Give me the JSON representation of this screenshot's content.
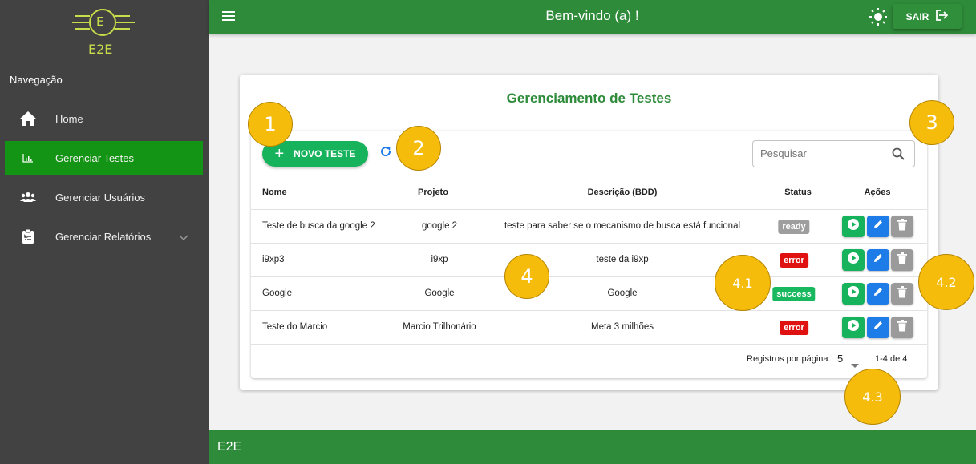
{
  "sidebar": {
    "logo_letter": "E",
    "logo_text": "E2E",
    "nav_title": "Navegação",
    "items": [
      {
        "label": "Home",
        "icon": "home-icon"
      },
      {
        "label": "Gerenciar Testes",
        "icon": "bar-chart-icon",
        "active": true
      },
      {
        "label": "Gerenciar Usuários",
        "icon": "users-icon"
      },
      {
        "label": "Gerenciar Relatórios",
        "icon": "clipboard-icon"
      }
    ]
  },
  "header": {
    "title": "Bem-vindo (a) !",
    "sair_label": "SAIR"
  },
  "card": {
    "title": "Gerenciamento de Testes",
    "new_button_label": "NOVO TESTE",
    "search_placeholder": "Pesquisar",
    "columns": [
      "Nome",
      "Projeto",
      "Descrição (BDD)",
      "Status",
      "Ações"
    ],
    "rows": [
      {
        "nome": "Teste de busca da google 2",
        "projeto": "google 2",
        "descricao": "teste para saber se o mecanismo de busca está funcional",
        "status": "ready"
      },
      {
        "nome": "i9xp3",
        "projeto": "i9xp",
        "descricao": "teste da i9xp",
        "status": "error"
      },
      {
        "nome": "Google",
        "projeto": "Google",
        "descricao": "Google",
        "status": "success"
      },
      {
        "nome": "Teste do Marcio",
        "projeto": "Marcio Trilhonário",
        "descricao": "Meta 3 milhões",
        "status": "error"
      }
    ],
    "pagination": {
      "rows_per_page_label": "Registros por página:",
      "rows_per_page": "5",
      "range": "1-4 de 4"
    }
  },
  "annotations": [
    "1",
    "2",
    "3",
    "4",
    "4.1",
    "4.2",
    "4.3"
  ],
  "footer": {
    "text": "E2E"
  },
  "colors": {
    "sidebar_bg": "#424242",
    "header_bg": "#2e8b3a",
    "active_nav": "#149414",
    "primary_green": "#17b35c",
    "edit_blue": "#1e7ce8",
    "error_red": "#e01111",
    "annotation_yellow": "#f5bc0c"
  }
}
